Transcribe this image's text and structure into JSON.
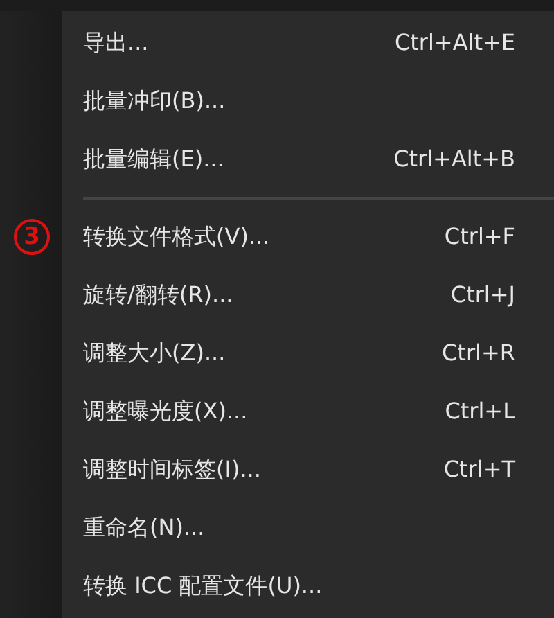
{
  "menu": {
    "items": [
      {
        "kind": "item",
        "label": "导出...",
        "shortcut": "Ctrl+Alt+E"
      },
      {
        "kind": "item",
        "label": "批量冲印(B)..."
      },
      {
        "kind": "item",
        "label": "批量编辑(E)...",
        "shortcut": "Ctrl+Alt+B"
      },
      {
        "kind": "separator"
      },
      {
        "kind": "item",
        "label": "转换文件格式(V)...",
        "shortcut": "Ctrl+F",
        "marker": "3"
      },
      {
        "kind": "item",
        "label": "旋转/翻转(R)...",
        "shortcut": "Ctrl+J"
      },
      {
        "kind": "item",
        "label": "调整大小(Z)...",
        "shortcut": "Ctrl+R"
      },
      {
        "kind": "item",
        "label": "调整曝光度(X)...",
        "shortcut": "Ctrl+L"
      },
      {
        "kind": "item",
        "label": "调整时间标签(I)...",
        "shortcut": "Ctrl+T"
      },
      {
        "kind": "item",
        "label": "重命名(N)..."
      },
      {
        "kind": "item",
        "label": "转换 ICC 配置文件(U)..."
      }
    ]
  }
}
